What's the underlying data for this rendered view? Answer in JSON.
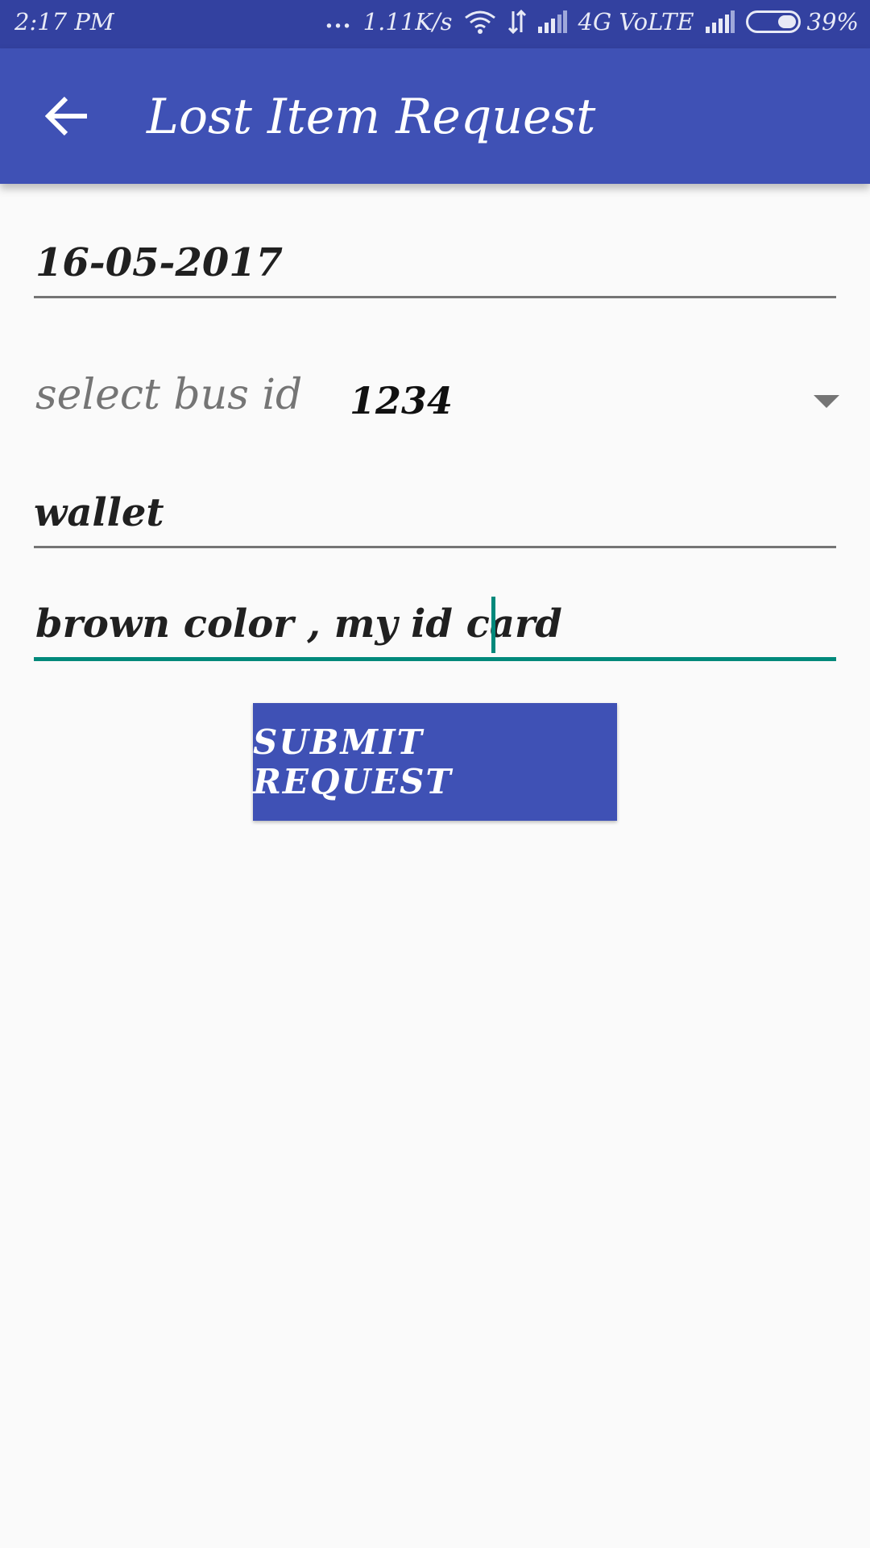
{
  "status_bar": {
    "time": "2:17 PM",
    "dots": "...",
    "speed": "1.11K/s",
    "network_type": "4G VoLTE",
    "battery_percent": "39%",
    "battery_level": 0.39
  },
  "app_bar": {
    "title": "Lost Item Request",
    "back_icon": "arrow-back-icon"
  },
  "form": {
    "date_value": "16-05-2017",
    "bus_label": "select bus id",
    "bus_selected": "1234",
    "item_value": "wallet",
    "description_value": "brown color , my id card",
    "focus_color": "#00897b"
  },
  "actions": {
    "submit_label": "SUBMIT REQUEST"
  },
  "colors": {
    "primary": "#3f51b5",
    "status_bar": "#3341a0",
    "accent": "#00897b"
  }
}
